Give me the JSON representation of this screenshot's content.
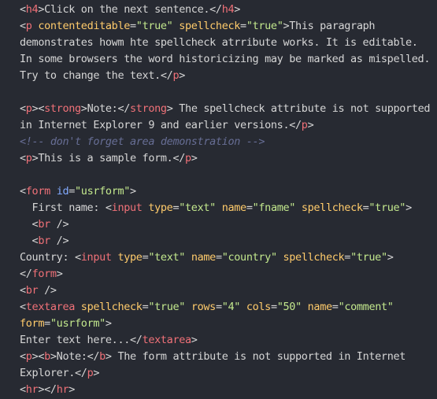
{
  "colors": {
    "background": "#272a32",
    "plain": "#d6d6d6",
    "tag": "#f07178",
    "attr": "#ffcb6b",
    "id_attr": "#82aaff",
    "string": "#c3e88d",
    "comment": "#676e95"
  },
  "code_lines": [
    [
      [
        "plain",
        "<"
      ],
      [
        "tag",
        "h4"
      ],
      [
        "plain",
        ">Click on the next sentence.</"
      ],
      [
        "tag",
        "h4"
      ],
      [
        "plain",
        ">"
      ]
    ],
    [
      [
        "plain",
        "<"
      ],
      [
        "tag",
        "p"
      ],
      [
        "plain",
        " "
      ],
      [
        "attr",
        "contenteditable"
      ],
      [
        "plain",
        "="
      ],
      [
        "string",
        "\"true\""
      ],
      [
        "plain",
        " "
      ],
      [
        "attr",
        "spellcheck"
      ],
      [
        "plain",
        "="
      ],
      [
        "string",
        "\"true\""
      ],
      [
        "plain",
        ">This paragraph"
      ]
    ],
    [
      [
        "plain",
        "demonstrates howm hte spellcheck atrribute works. It is editable."
      ]
    ],
    [
      [
        "plain",
        "In some browsers the word historicizing may be marked as mispelled."
      ]
    ],
    [
      [
        "plain",
        "Try to change the text.</"
      ],
      [
        "tag",
        "p"
      ],
      [
        "plain",
        ">"
      ]
    ],
    [],
    [
      [
        "plain",
        "<"
      ],
      [
        "tag",
        "p"
      ],
      [
        "plain",
        "><"
      ],
      [
        "tag",
        "strong"
      ],
      [
        "plain",
        ">Note:</"
      ],
      [
        "tag",
        "strong"
      ],
      [
        "plain",
        "> The spellcheck attribute is not supported"
      ]
    ],
    [
      [
        "plain",
        "in Internet Explorer 9 and earlier versions.</"
      ],
      [
        "tag",
        "p"
      ],
      [
        "plain",
        ">"
      ]
    ],
    [
      [
        "comment",
        "<!-- don't forget area demonstration -->"
      ]
    ],
    [
      [
        "plain",
        "<"
      ],
      [
        "tag",
        "p"
      ],
      [
        "plain",
        ">This is a sample form.</"
      ],
      [
        "tag",
        "p"
      ],
      [
        "plain",
        ">"
      ]
    ],
    [],
    [
      [
        "plain",
        "<"
      ],
      [
        "tag",
        "form"
      ],
      [
        "plain",
        " "
      ],
      [
        "id_attr",
        "id"
      ],
      [
        "plain",
        "="
      ],
      [
        "string",
        "\"usrform\""
      ],
      [
        "plain",
        ">"
      ]
    ],
    [
      [
        "plain",
        "  First name: <"
      ],
      [
        "tag",
        "input"
      ],
      [
        "plain",
        " "
      ],
      [
        "attr",
        "type"
      ],
      [
        "plain",
        "="
      ],
      [
        "string",
        "\"text\""
      ],
      [
        "plain",
        " "
      ],
      [
        "attr",
        "name"
      ],
      [
        "plain",
        "="
      ],
      [
        "string",
        "\"fname\""
      ],
      [
        "plain",
        " "
      ],
      [
        "attr",
        "spellcheck"
      ],
      [
        "plain",
        "="
      ],
      [
        "string",
        "\"true\""
      ],
      [
        "plain",
        ">"
      ]
    ],
    [
      [
        "plain",
        "  <"
      ],
      [
        "tag",
        "br"
      ],
      [
        "plain",
        " />"
      ]
    ],
    [
      [
        "plain",
        "  <"
      ],
      [
        "tag",
        "br"
      ],
      [
        "plain",
        " />"
      ]
    ],
    [
      [
        "plain",
        "Country: <"
      ],
      [
        "tag",
        "input"
      ],
      [
        "plain",
        " "
      ],
      [
        "attr",
        "type"
      ],
      [
        "plain",
        "="
      ],
      [
        "string",
        "\"text\""
      ],
      [
        "plain",
        " "
      ],
      [
        "attr",
        "name"
      ],
      [
        "plain",
        "="
      ],
      [
        "string",
        "\"country\""
      ],
      [
        "plain",
        " "
      ],
      [
        "attr",
        "spellcheck"
      ],
      [
        "plain",
        "="
      ],
      [
        "string",
        "\"true\""
      ],
      [
        "plain",
        ">"
      ]
    ],
    [
      [
        "plain",
        "</"
      ],
      [
        "tag",
        "form"
      ],
      [
        "plain",
        ">"
      ]
    ],
    [
      [
        "plain",
        "<"
      ],
      [
        "tag",
        "br"
      ],
      [
        "plain",
        " />"
      ]
    ],
    [
      [
        "plain",
        "<"
      ],
      [
        "tag",
        "textarea"
      ],
      [
        "plain",
        " "
      ],
      [
        "attr",
        "spellcheck"
      ],
      [
        "plain",
        "="
      ],
      [
        "string",
        "\"true\""
      ],
      [
        "plain",
        " "
      ],
      [
        "attr",
        "rows"
      ],
      [
        "plain",
        "="
      ],
      [
        "string",
        "\"4\""
      ],
      [
        "plain",
        " "
      ],
      [
        "attr",
        "cols"
      ],
      [
        "plain",
        "="
      ],
      [
        "string",
        "\"50\""
      ],
      [
        "plain",
        " "
      ],
      [
        "attr",
        "name"
      ],
      [
        "plain",
        "="
      ],
      [
        "string",
        "\"comment\""
      ]
    ],
    [
      [
        "attr",
        "form"
      ],
      [
        "plain",
        "="
      ],
      [
        "string",
        "\"usrform\""
      ],
      [
        "plain",
        ">"
      ]
    ],
    [
      [
        "plain",
        "Enter text here...</"
      ],
      [
        "tag",
        "textarea"
      ],
      [
        "plain",
        ">"
      ]
    ],
    [
      [
        "plain",
        "<"
      ],
      [
        "tag",
        "p"
      ],
      [
        "plain",
        "><"
      ],
      [
        "tag",
        "b"
      ],
      [
        "plain",
        ">Note:</"
      ],
      [
        "tag",
        "b"
      ],
      [
        "plain",
        "> The form attribute is not supported in Internet"
      ]
    ],
    [
      [
        "plain",
        "Explorer.</"
      ],
      [
        "tag",
        "p"
      ],
      [
        "plain",
        ">"
      ]
    ],
    [
      [
        "plain",
        "<"
      ],
      [
        "tag",
        "hr"
      ],
      [
        "plain",
        "></"
      ],
      [
        "tag",
        "hr"
      ],
      [
        "plain",
        ">"
      ]
    ]
  ]
}
